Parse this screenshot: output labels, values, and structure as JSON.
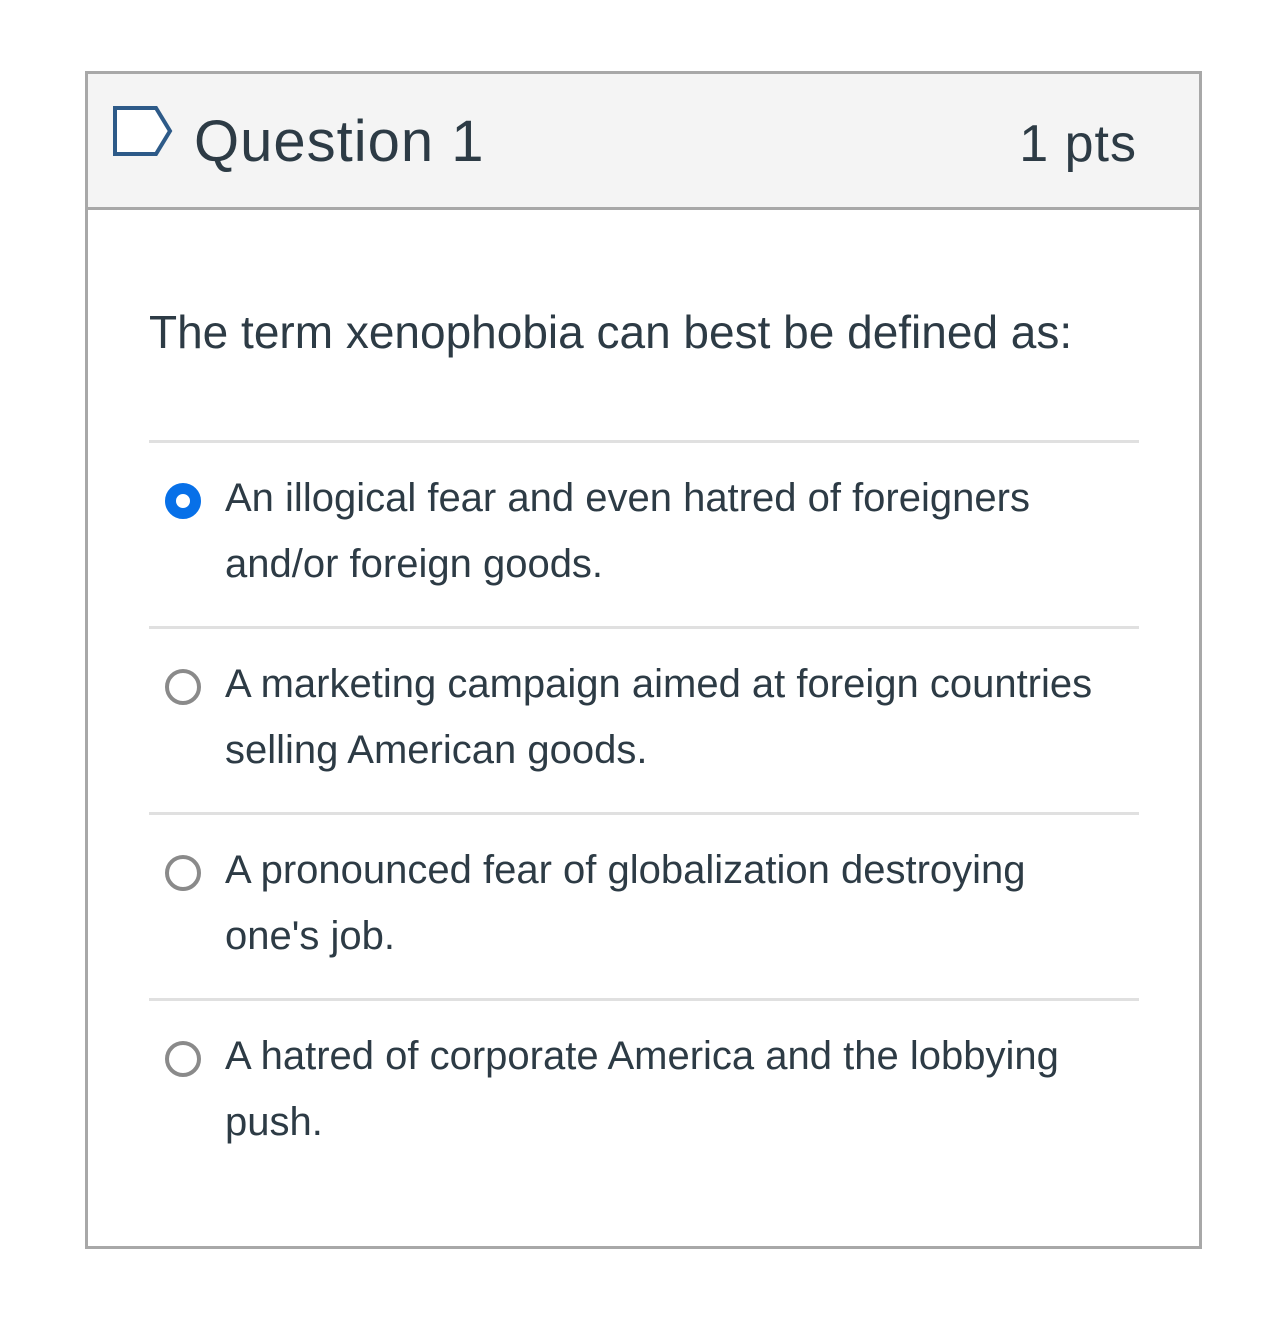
{
  "question": {
    "title": "Question 1",
    "points": "1 pts",
    "text": "The term xenophobia can best be defined as:",
    "flag_icon": "flag-outline-icon"
  },
  "answers": [
    {
      "label": "An illogical fear and even hatred of foreigners and/or foreign goods.",
      "selected": true
    },
    {
      "label": "A marketing campaign aimed at foreign countries selling American goods.",
      "selected": false
    },
    {
      "label": "A pronounced fear of globalization destroying one's job.",
      "selected": false
    },
    {
      "label": "A hatred of corporate America and the lobbying push.",
      "selected": false
    }
  ],
  "colors": {
    "selected_radio": "#0770e8",
    "text": "#2d3b45",
    "header_bg": "#f4f4f4",
    "border": "#a8a8a8"
  }
}
